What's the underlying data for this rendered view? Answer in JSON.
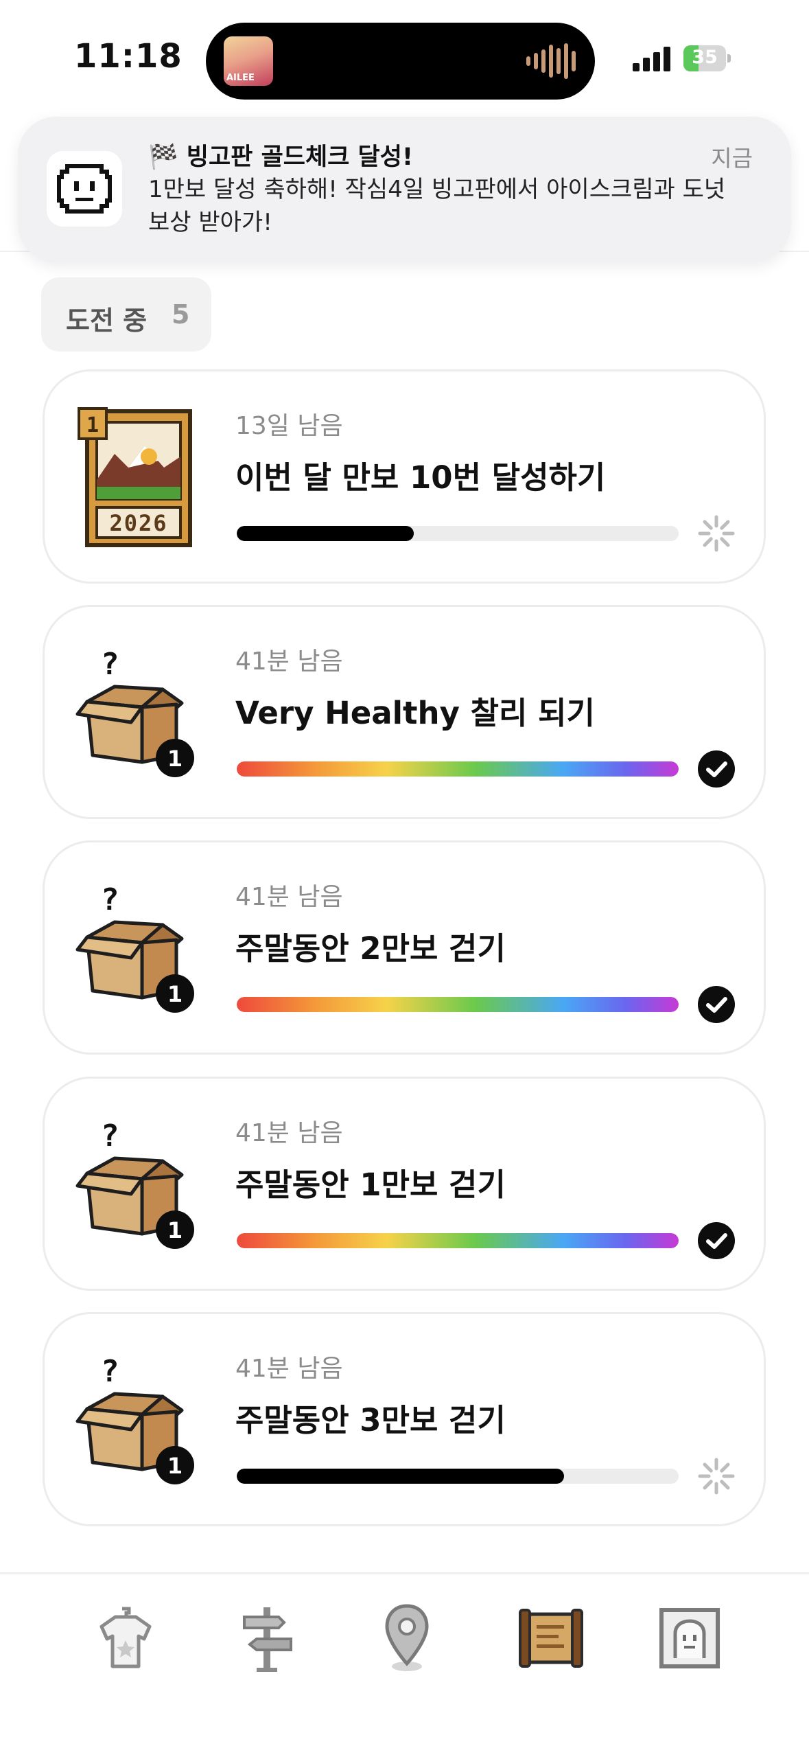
{
  "status_bar": {
    "time": "11:18",
    "battery_level": "35",
    "battery_fraction": 0.35,
    "island_art_caption": "AILEE"
  },
  "notification": {
    "title_emoji": "🏁",
    "title": "빙고판 골드체크 달성!",
    "body": "1만보 달성 축하해! 작심4일 빙고판에서 아이스크림과 도넛 보상 받아가!",
    "time": "지금",
    "icon": "smiley-face-icon"
  },
  "section": {
    "label": "도전 중",
    "count": "5"
  },
  "challenges": [
    {
      "remaining": "13일 남음",
      "title": "이번 달 만보 10번 달성하기",
      "progress": 0.4,
      "style": "black",
      "status": "in-progress",
      "icon": "calendar-2026-badge-icon",
      "badge_number": "1",
      "badge_year": "2026"
    },
    {
      "remaining": "41분 남음",
      "title": "Very Healthy 찰리 되기",
      "progress": 1.0,
      "style": "rainbow",
      "status": "complete",
      "icon": "mystery-box-icon",
      "badge_number": "1"
    },
    {
      "remaining": "41분 남음",
      "title": "주말동안 2만보 걷기",
      "progress": 1.0,
      "style": "rainbow",
      "status": "complete",
      "icon": "mystery-box-icon",
      "badge_number": "1"
    },
    {
      "remaining": "41분 남음",
      "title": "주말동안 1만보 걷기",
      "progress": 1.0,
      "style": "rainbow",
      "status": "complete",
      "icon": "mystery-box-icon",
      "badge_number": "1"
    },
    {
      "remaining": "41분 남음",
      "title": "주말동안 3만보 걷기",
      "progress": 0.74,
      "style": "black",
      "status": "in-progress",
      "icon": "mystery-box-icon",
      "badge_number": "1"
    }
  ],
  "tabbar": {
    "items": [
      {
        "icon": "shirt-icon"
      },
      {
        "icon": "signpost-icon"
      },
      {
        "icon": "map-pin-icon"
      },
      {
        "icon": "scroll-icon",
        "active": true
      },
      {
        "icon": "profile-frame-icon"
      }
    ]
  }
}
